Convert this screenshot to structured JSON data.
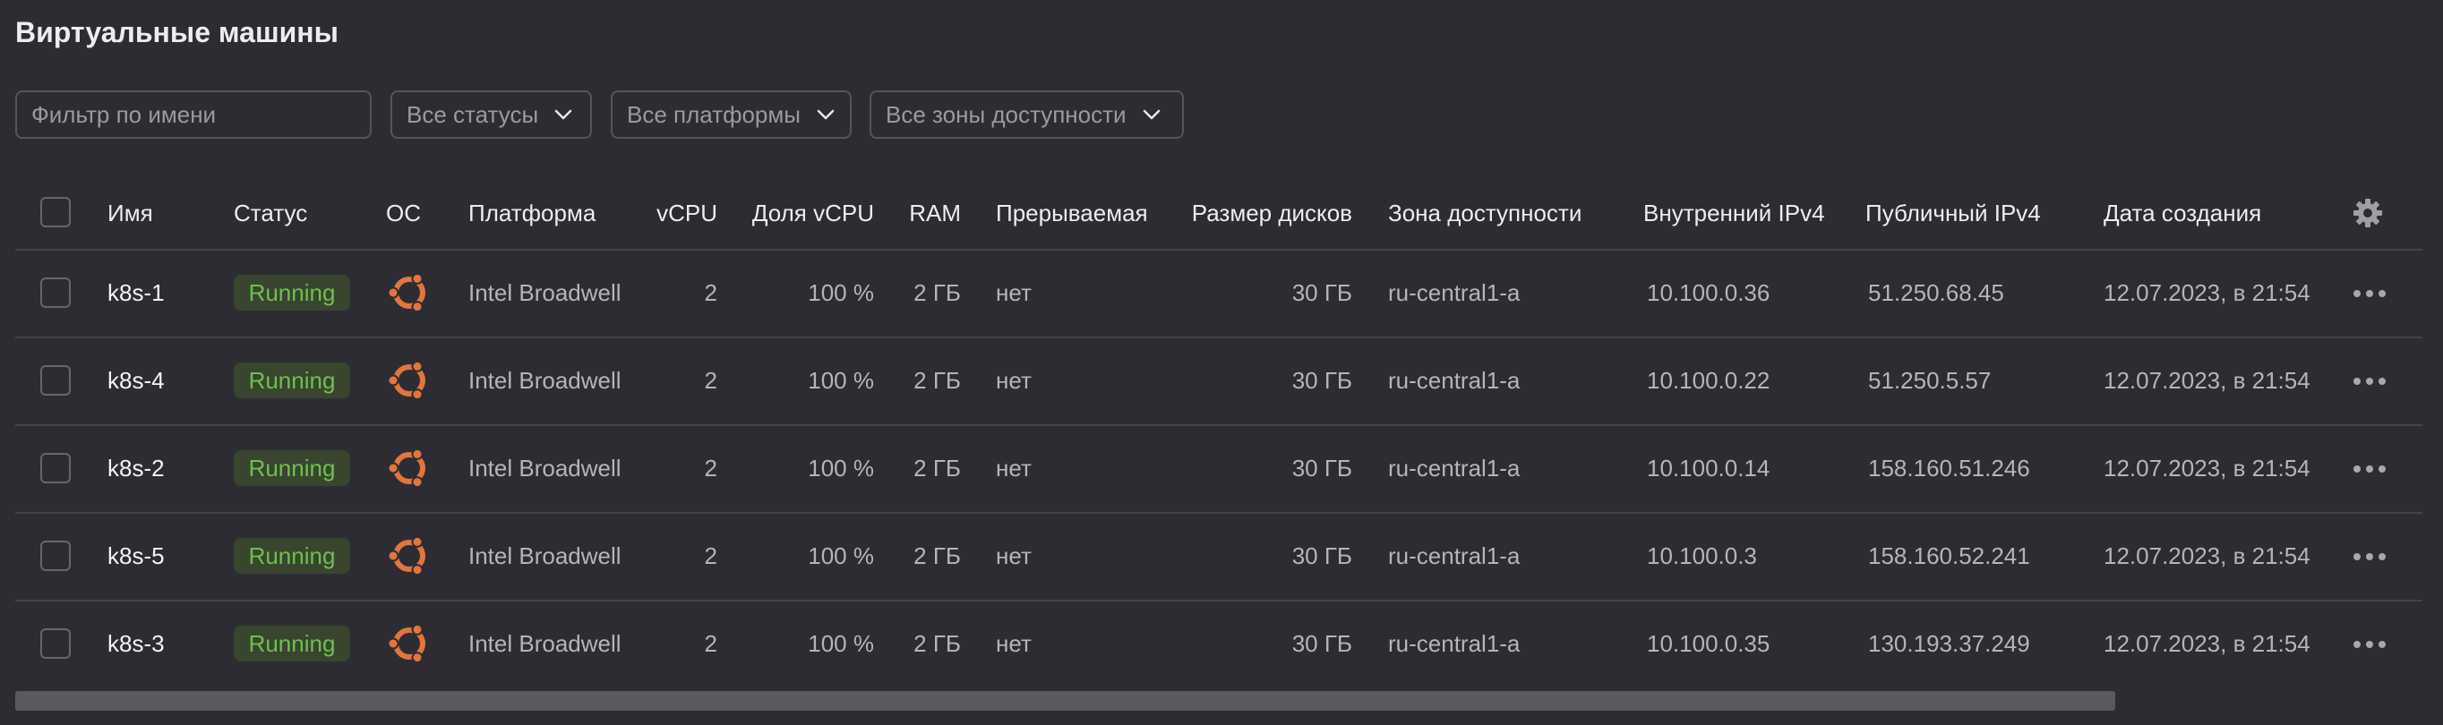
{
  "page": {
    "title": "Виртуальные машины"
  },
  "filters": {
    "name_placeholder": "Фильтр по имени",
    "status": "Все статусы",
    "platform": "Все платформы",
    "zone": "Все зоны доступности"
  },
  "table": {
    "columns": {
      "name": "Имя",
      "status": "Статус",
      "os": "ОС",
      "platform": "Платформа",
      "vcpu": "vCPU",
      "vcpu_share": "Доля vCPU",
      "ram": "RAM",
      "preemptible": "Прерываемая",
      "disk": "Размер дисков",
      "zone": "Зона доступности",
      "internal_ip": "Внутренний IPv4",
      "public_ip": "Публичный IPv4",
      "created": "Дата создания"
    },
    "rows": [
      {
        "name": "k8s-1",
        "status": "Running",
        "os": "ubuntu-icon",
        "platform": "Intel Broadwell",
        "vcpu": "2",
        "vcpu_share": "100 %",
        "ram": "2 ГБ",
        "preemptible": "нет",
        "disk": "30 ГБ",
        "zone": "ru-central1-a",
        "internal_ip": "10.100.0.36",
        "public_ip": "51.250.68.45",
        "created": "12.07.2023, в 21:54"
      },
      {
        "name": "k8s-4",
        "status": "Running",
        "os": "ubuntu-icon",
        "platform": "Intel Broadwell",
        "vcpu": "2",
        "vcpu_share": "100 %",
        "ram": "2 ГБ",
        "preemptible": "нет",
        "disk": "30 ГБ",
        "zone": "ru-central1-a",
        "internal_ip": "10.100.0.22",
        "public_ip": "51.250.5.57",
        "created": "12.07.2023, в 21:54"
      },
      {
        "name": "k8s-2",
        "status": "Running",
        "os": "ubuntu-icon",
        "platform": "Intel Broadwell",
        "vcpu": "2",
        "vcpu_share": "100 %",
        "ram": "2 ГБ",
        "preemptible": "нет",
        "disk": "30 ГБ",
        "zone": "ru-central1-a",
        "internal_ip": "10.100.0.14",
        "public_ip": "158.160.51.246",
        "created": "12.07.2023, в 21:54"
      },
      {
        "name": "k8s-5",
        "status": "Running",
        "os": "ubuntu-icon",
        "platform": "Intel Broadwell",
        "vcpu": "2",
        "vcpu_share": "100 %",
        "ram": "2 ГБ",
        "preemptible": "нет",
        "disk": "30 ГБ",
        "zone": "ru-central1-a",
        "internal_ip": "10.100.0.3",
        "public_ip": "158.160.52.241",
        "created": "12.07.2023, в 21:54"
      },
      {
        "name": "k8s-3",
        "status": "Running",
        "os": "ubuntu-icon",
        "platform": "Intel Broadwell",
        "vcpu": "2",
        "vcpu_share": "100 %",
        "ram": "2 ГБ",
        "preemptible": "нет",
        "disk": "30 ГБ",
        "zone": "ru-central1-a",
        "internal_ip": "10.100.0.35",
        "public_ip": "130.193.37.249",
        "created": "12.07.2023, в 21:54"
      }
    ]
  },
  "colors": {
    "background": "#2d2c33",
    "status_running_text": "#6ec04f",
    "status_running_bg": "#39452f",
    "ubuntu_orange": "#e5743d"
  }
}
